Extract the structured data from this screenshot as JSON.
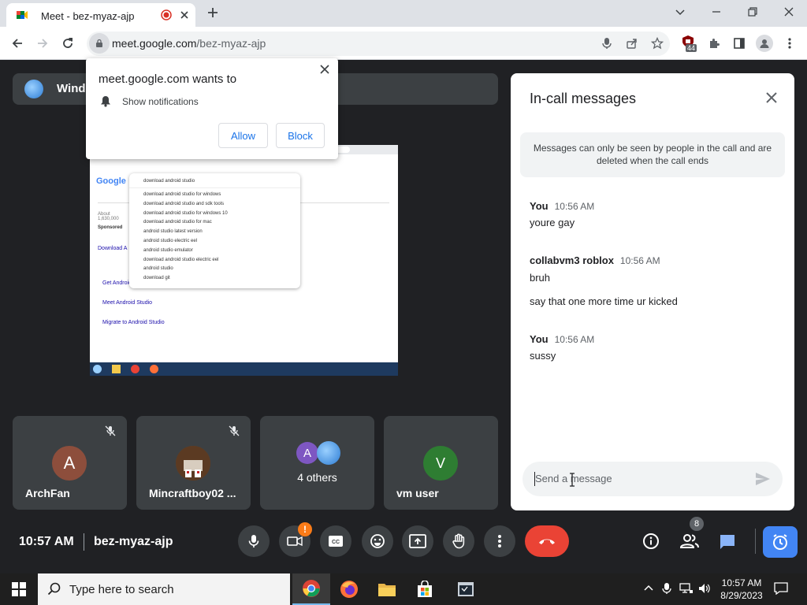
{
  "browser": {
    "tab_title": "Meet - bez-myaz-ajp",
    "url_host": "meet.google.com",
    "url_path": "/bez-myaz-ajp",
    "extension_badge": "44"
  },
  "popup": {
    "title": "meet.google.com wants to",
    "permission": "Show notifications",
    "allow": "Allow",
    "block": "Block"
  },
  "screen_share": {
    "window_label": "Windo",
    "search_query": "download android studio",
    "suggestions": [
      "download android studio for windows",
      "download android studio and sdk tools",
      "download android studio for windows 10",
      "download android studio for mac",
      "android studio latest version",
      "android studio electric eel",
      "android studio emulator",
      "download android studio electric eel",
      "android studio",
      "download git"
    ],
    "results": [
      "Get Android Studio",
      "Meet Android Studio",
      "Migrate to Android Studio"
    ]
  },
  "participants": [
    {
      "name": "ArchFan",
      "initial": "A",
      "color": "#8d4e3c"
    },
    {
      "name": "Mincraftboy02 ...",
      "initial": ""
    },
    {
      "name": "",
      "label": "4 others",
      "initial": "A",
      "color": "#7e57c2"
    },
    {
      "name": "vm user",
      "initial": "V",
      "color": "#2e7d32"
    }
  ],
  "panel": {
    "title": "In-call messages",
    "notice": "Messages can only be seen by people in the call and are deleted when the call ends",
    "messages": [
      {
        "sender": "You",
        "time": "10:56 AM",
        "lines": [
          "youre gay"
        ]
      },
      {
        "sender": "collabvm3 roblox",
        "time": "10:56 AM",
        "lines": [
          "bruh",
          "say that one more time ur kicked"
        ]
      },
      {
        "sender": "You",
        "time": "10:56 AM",
        "lines": [
          "sussy"
        ]
      }
    ],
    "input_placeholder": "Send a message"
  },
  "meeting": {
    "time": "10:57 AM",
    "code": "bez-myaz-ajp",
    "people_count": "8"
  },
  "taskbar": {
    "search_placeholder": "Type here to search",
    "time": "10:57 AM",
    "date": "8/29/2023"
  },
  "colors": {
    "end_call": "#ea4335",
    "accent": "#8ab4f8",
    "activity": "#4285f4"
  }
}
